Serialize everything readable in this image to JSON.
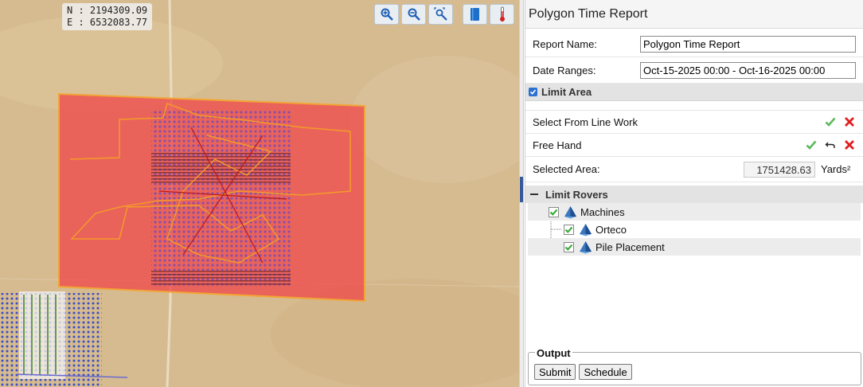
{
  "map": {
    "coords": {
      "north": "N : 2194309.09",
      "east": "E : 6532083.77"
    },
    "tools": [
      "zoom-in-icon",
      "zoom-out-icon",
      "zoom-extents-icon",
      "layers-book-icon",
      "thermometer-icon"
    ]
  },
  "panel": {
    "title": "Polygon Time Report",
    "report_name": {
      "label": "Report Name:",
      "value": "Polygon Time Report"
    },
    "date_ranges": {
      "label": "Date Ranges:",
      "value": "Oct-15-2025 00:00 - Oct-16-2025 00:00"
    },
    "limit_area": {
      "header": "Limit Area",
      "checked": true,
      "select_line_work": "Select From Line Work",
      "free_hand": "Free Hand",
      "selected_area_label": "Selected Area:",
      "selected_area_value": "1751428.63",
      "selected_area_unit": "Yards²"
    },
    "limit_rovers": {
      "header": "Limit Rovers",
      "root": "Machines",
      "children": [
        "Orteco",
        "Pile Placement"
      ]
    },
    "output": {
      "legend": "Output",
      "submit": "Submit",
      "schedule": "Schedule"
    }
  },
  "colors": {
    "accent": "#36599a",
    "confirm": "#5cb85c",
    "cancel": "#e02020",
    "polygon": "#f04a4a"
  }
}
